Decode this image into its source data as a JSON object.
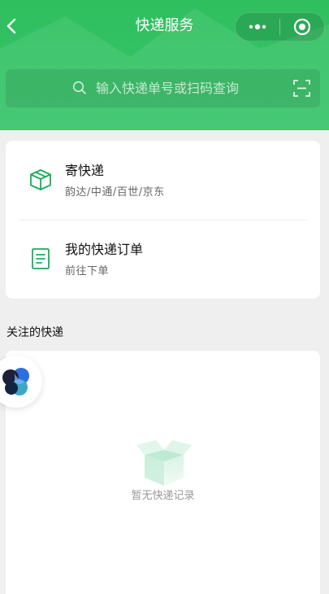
{
  "header": {
    "title": "快递服务",
    "background_color": "#2fbf5f",
    "back_icon": "chevron-left-icon",
    "more_icon": "more-dots-icon",
    "close_icon": "target-circle-icon"
  },
  "search": {
    "placeholder": "输入快递单号或扫码查询",
    "search_icon": "search-icon",
    "scan_icon": "scan-icon"
  },
  "services": [
    {
      "title": "寄快递",
      "subtitle": "韵达/中通/百世/京东",
      "icon": "package-box-icon"
    },
    {
      "title": "我的快递订单",
      "subtitle": "前往下单",
      "icon": "order-document-icon"
    }
  ],
  "favorites": {
    "section_title": "关注的快递",
    "empty_text": "暂无快递记录",
    "empty_icon": "empty-box-icon"
  },
  "floating_assistant": {
    "icon": "assistant-logo-icon"
  },
  "colors": {
    "accent": "#2fbf5f",
    "icon_green": "#1aad5b"
  }
}
